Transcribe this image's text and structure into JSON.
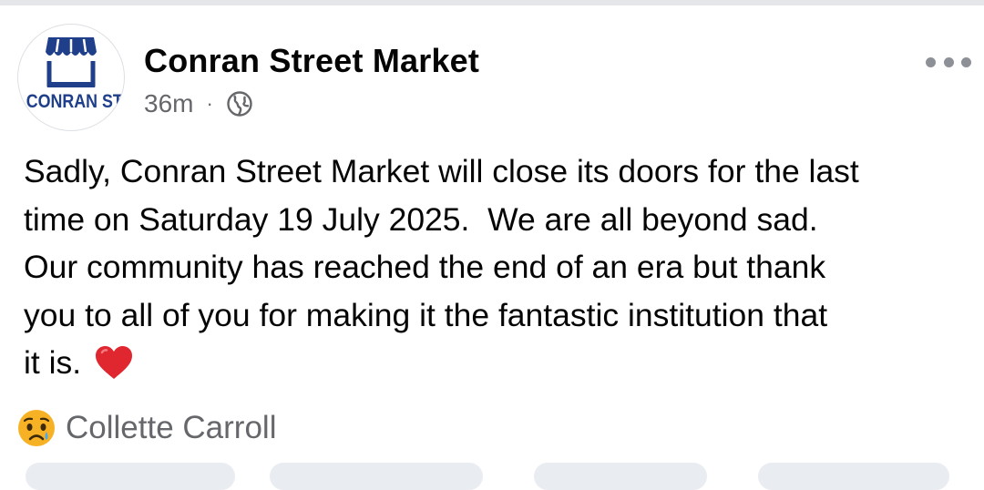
{
  "post": {
    "page_name": "Conran Street Market",
    "timestamp": "36m",
    "separator": "·",
    "audience_icon": "globe-icon",
    "more_icon": "more-options-icon",
    "avatar": {
      "logo_text": "CONRAN ST",
      "brand_color": "#1f3f8a"
    },
    "text_lines": [
      "Sadly, Conran Street Market will close its doors for the last",
      "time on Saturday 19 July 2025.  We are all beyond sad.",
      "Our community has reached the end of an era but thank",
      "you to all of you for making it the fantastic institution that",
      "it is."
    ],
    "emoji": "red-heart-icon"
  },
  "reactions": {
    "icon": "sad-crying-face-icon",
    "name": "Collette Carroll"
  },
  "colors": {
    "secondary_text": "#65676b",
    "primary_text": "#050505",
    "divider": "#e4e6ea",
    "heart": "#e0262f",
    "sad_face": "#f7b125"
  }
}
